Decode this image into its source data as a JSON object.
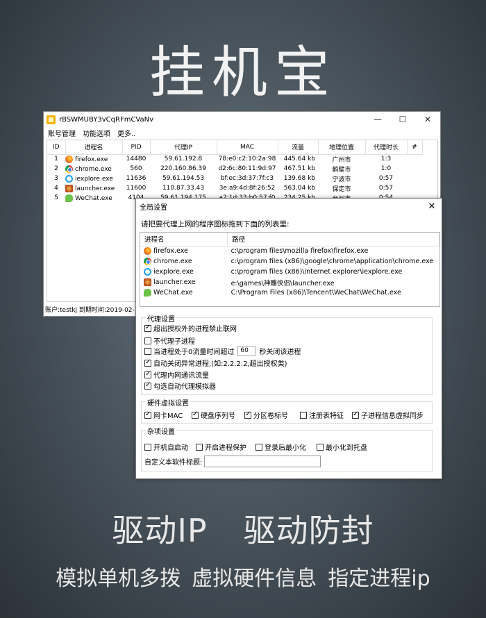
{
  "hero": {
    "title": "挂机宝"
  },
  "main_window": {
    "title": "rBSWMUBY3vCqRFmCVaNv",
    "buttons": {
      "minimize": "—",
      "maximize": "☐",
      "close": "✕"
    },
    "menu": [
      "账号管理",
      "功能选项",
      "更多.."
    ],
    "columns": [
      "ID",
      "进程名",
      "PID",
      "代理IP",
      "MAC",
      "流量",
      "地理位置",
      "代理时长",
      "#"
    ],
    "rows": [
      {
        "id": "1",
        "icon": "firefox-icon",
        "name": "firefox.exe",
        "pid": "14480",
        "ip": "59.61.192.8",
        "mac": "78:e0:c2:10:2a:98",
        "traffic": "445.64 kb",
        "location": "广州市",
        "duration": "1:3"
      },
      {
        "id": "2",
        "icon": "chrome-icon",
        "name": "chrome.exe",
        "pid": "560",
        "ip": "220.160.86.39",
        "mac": "d2:6c:80:11:9d:97",
        "traffic": "467.51 kb",
        "location": "鹤壁市",
        "duration": "1:0"
      },
      {
        "id": "3",
        "icon": "ie-icon",
        "name": "iexplore.exe",
        "pid": "11636",
        "ip": "59.61.194.53",
        "mac": "bf:ec:3d:37:7f:c3",
        "traffic": "139.68 kb",
        "location": "宁波市",
        "duration": "0:57"
      },
      {
        "id": "4",
        "icon": "launcher-icon",
        "name": "launcher.exe",
        "pid": "11600",
        "ip": "110.87.33.43",
        "mac": "3e:a9:4d:8f:26:52",
        "traffic": "563.04 kb",
        "location": "保定市",
        "duration": "0:57"
      },
      {
        "id": "5",
        "icon": "wechat-icon",
        "name": "WeChat.exe",
        "pid": "4104",
        "ip": "59.61.194.175",
        "mac": "a2:1d:33:b0:57:f0",
        "traffic": "234.25 kb",
        "location": "台州市",
        "duration": "0:54"
      }
    ],
    "status": "账户:testkj  到期时间:2019-02-"
  },
  "dialog": {
    "title": "全局设置",
    "close": "✕",
    "instruction": "请把要代理上网的程序图标拖到下面的列表里:",
    "columns": [
      "进程名",
      "路径"
    ],
    "rows": [
      {
        "icon": "firefox-icon",
        "name": "firefox.exe",
        "path": "c:\\program files\\mozilla firefox\\firefox.exe"
      },
      {
        "icon": "chrome-icon",
        "name": "chrome.exe",
        "path": "c:\\program files (x86)\\google\\chrome\\application\\chrome.exe"
      },
      {
        "icon": "ie-icon",
        "name": "iexplore.exe",
        "path": "c:\\program files (x86)\\internet explorer\\iexplore.exe"
      },
      {
        "icon": "launcher-icon",
        "name": "launcher.exe",
        "path": "e:\\games\\神雕侠侣\\launcher.exe"
      },
      {
        "icon": "wechat-icon",
        "name": "WeChat.exe",
        "path": "C:\\Program Files (x86)\\Tencent\\WeChat\\WeChat.exe"
      }
    ],
    "proxy_group": {
      "label": "代理设置",
      "opt1": {
        "label": "超出授权外的进程禁止联网",
        "checked": true
      },
      "opt2": {
        "label": "不代理子进程",
        "checked": false
      },
      "opt3": {
        "label_before": "当进程处于0流量时间超过",
        "value": "60",
        "label_after": "秒关闭该进程",
        "checked": false
      },
      "opt4": {
        "label": "自动关闭异常进程,(如:2.2.2.2,超出授权类)",
        "checked": true
      },
      "opt5": {
        "label": "代理内网通讯流量",
        "checked": true
      },
      "opt6": {
        "label": "勾选自动代理模拟器",
        "checked": true
      }
    },
    "hardware_group": {
      "label": "硬件虚拟设置",
      "opt1": {
        "label": "网卡MAC",
        "checked": true
      },
      "opt2": {
        "label": "硬盘序列号",
        "checked": true
      },
      "opt3": {
        "label": "分区卷标号",
        "checked": true
      },
      "opt4": {
        "label": "注册表特征",
        "checked": false
      },
      "opt5": {
        "label": "子进程信息虚拟同步",
        "checked": true
      }
    },
    "misc_group": {
      "label": "杂项设置",
      "opt1": {
        "label": "开机自启动",
        "checked": false
      },
      "opt2": {
        "label": "开启进程保护",
        "checked": false
      },
      "opt3": {
        "label": "登录后最小化",
        "checked": false
      },
      "opt4": {
        "label": "最小化到托盘",
        "checked": false
      },
      "title_label": "自定义本软件标题:",
      "title_value": ""
    }
  },
  "taglines": {
    "line1": [
      "驱动IP",
      "驱动防封"
    ],
    "line2": [
      "模拟单机多拨",
      "虚拟硬件信息",
      "指定进程ip"
    ]
  },
  "colors": {
    "accent_icon": "#f0b400",
    "text_light": "#f2f2f2"
  }
}
